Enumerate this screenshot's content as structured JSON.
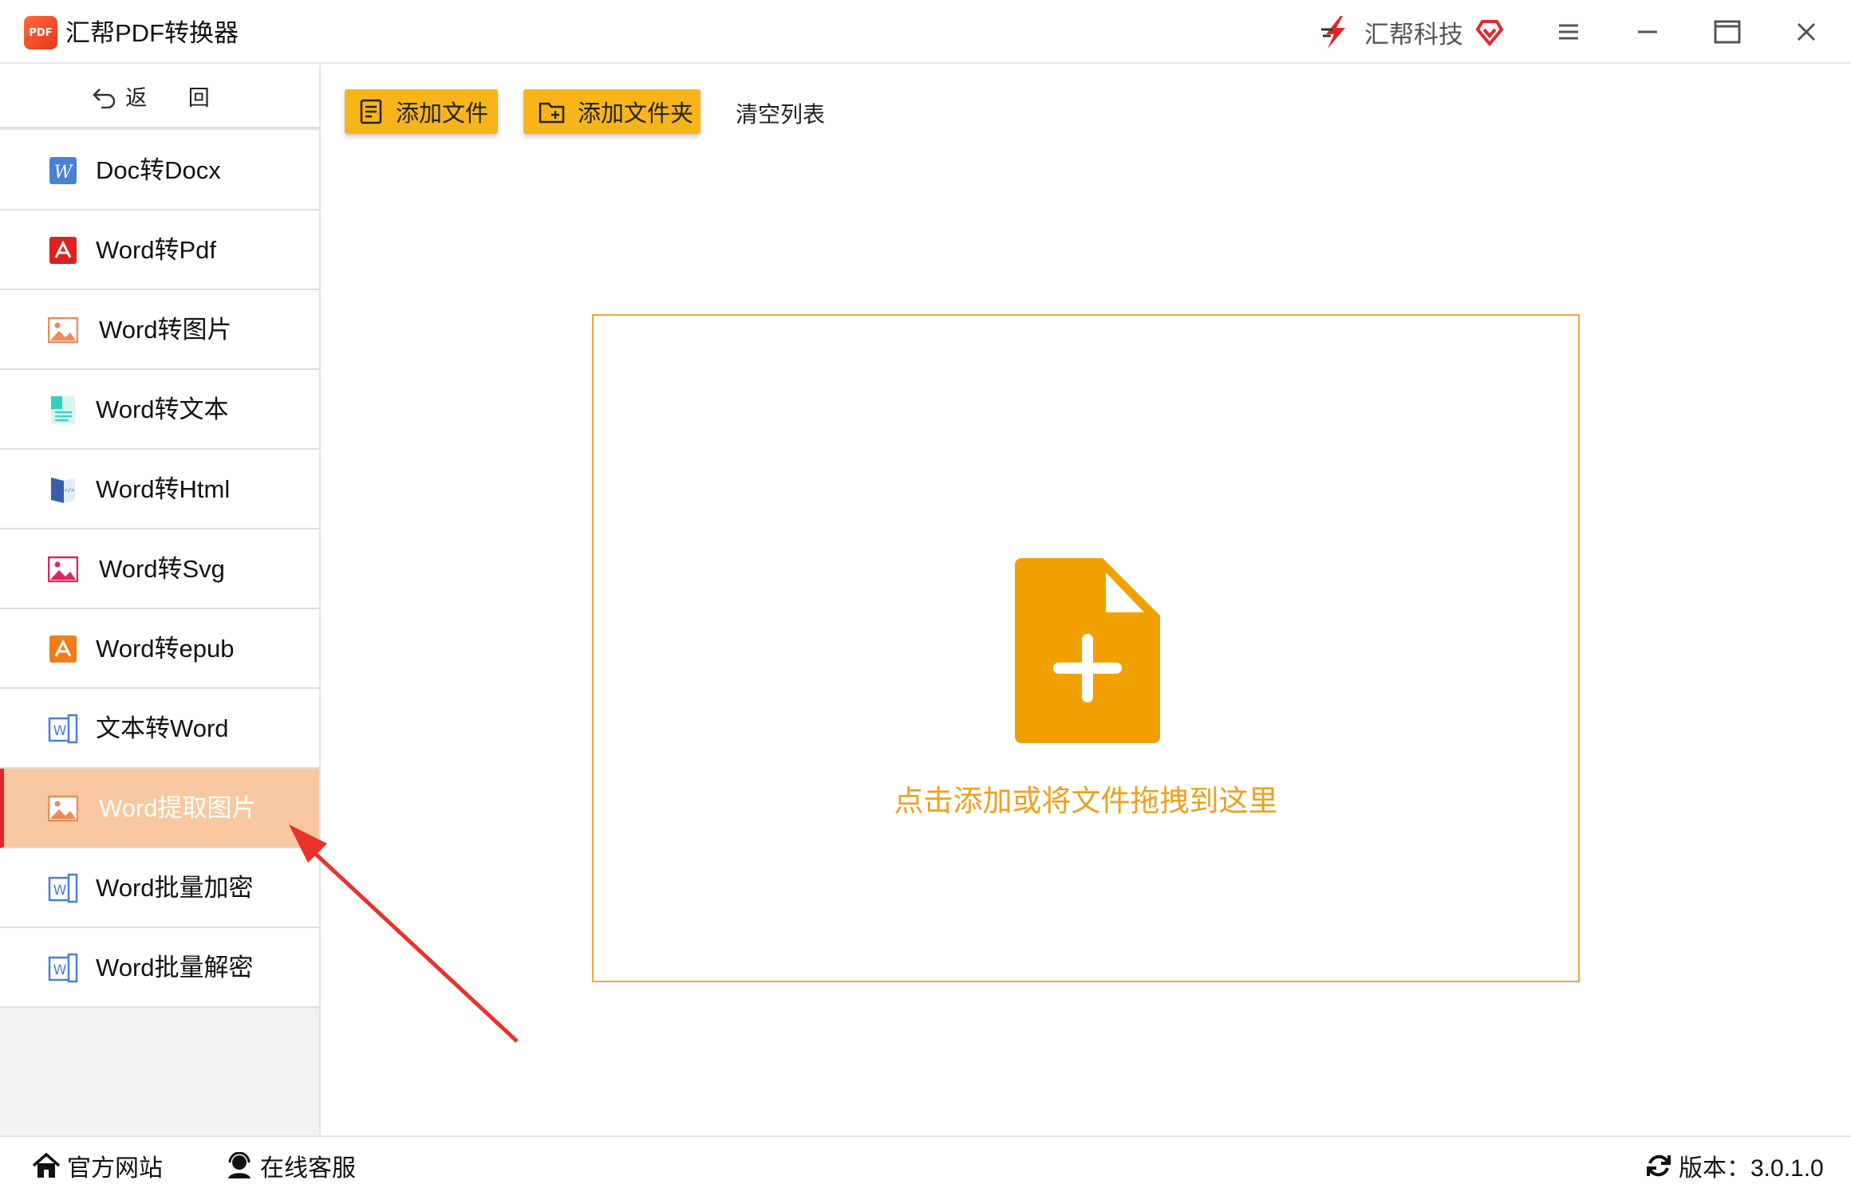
{
  "window": {
    "title": "汇帮PDF转换器",
    "brand": "汇帮科技",
    "logo_text": "PDF"
  },
  "sidebar": {
    "back_label": "返 回",
    "items": [
      {
        "label": "Doc转Docx",
        "icon": "word-w-icon"
      },
      {
        "label": "Word转Pdf",
        "icon": "pdf-acrobat-icon"
      },
      {
        "label": "Word转图片",
        "icon": "image-icon"
      },
      {
        "label": "Word转文本",
        "icon": "text-doc-icon"
      },
      {
        "label": "Word转Html",
        "icon": "html-book-icon"
      },
      {
        "label": "Word转Svg",
        "icon": "svg-image-icon"
      },
      {
        "label": "Word转epub",
        "icon": "epub-icon"
      },
      {
        "label": "文本转Word",
        "icon": "word-outline-icon"
      },
      {
        "label": "Word提取图片",
        "icon": "image-icon",
        "active": true
      },
      {
        "label": "Word批量加密",
        "icon": "word-outline-icon"
      },
      {
        "label": "Word批量解密",
        "icon": "word-outline-icon"
      }
    ]
  },
  "toolbar": {
    "add_file": "添加文件",
    "add_folder": "添加文件夹",
    "clear_list": "清空列表"
  },
  "dropzone": {
    "hint": "点击添加或将文件拖拽到这里"
  },
  "footer": {
    "website": "官方网站",
    "support": "在线客服",
    "version": "版本：3.0.1.0"
  },
  "colors": {
    "accent": "#f7b51a",
    "dropzone_border": "#f2a53d",
    "active_item_bg": "#f8c9a0",
    "active_item_marker": "#e5262b",
    "annotation_arrow": "#e8322a"
  }
}
